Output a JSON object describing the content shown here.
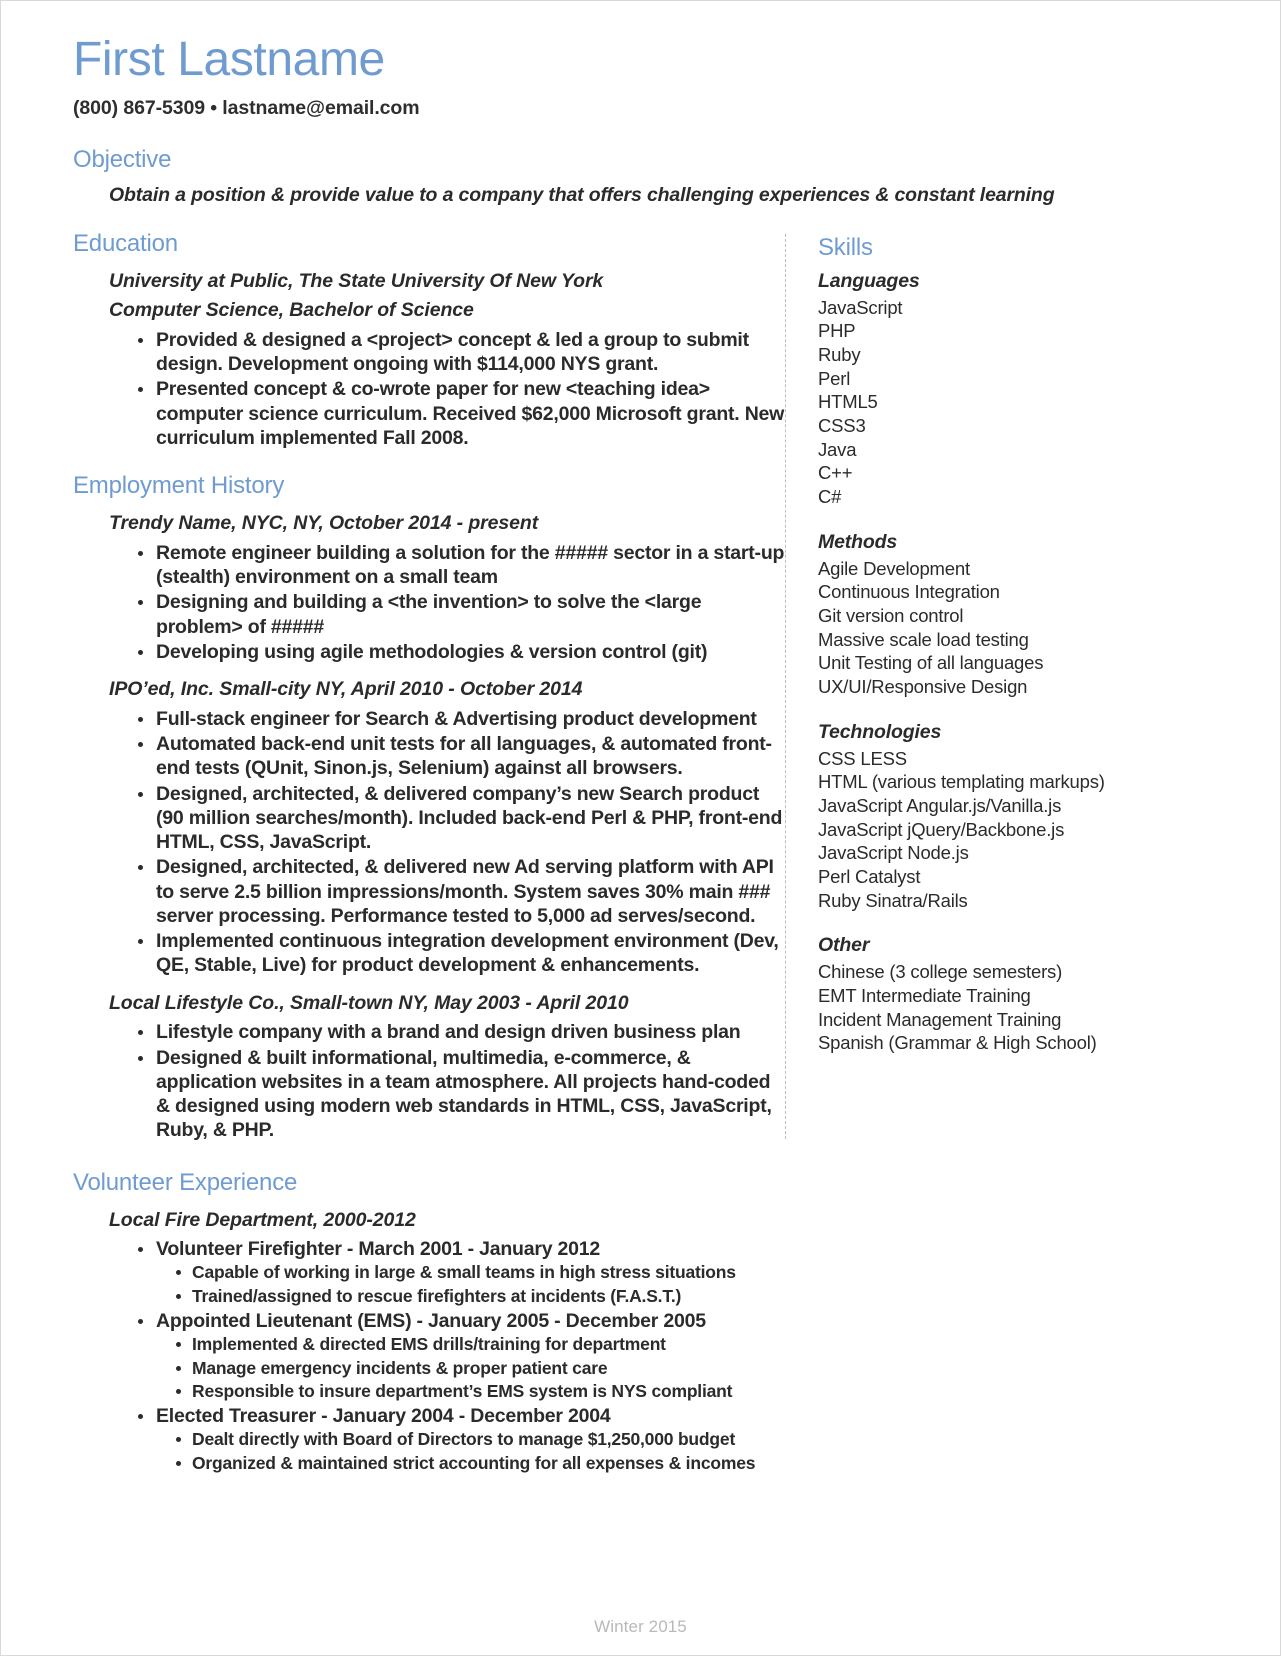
{
  "header": {
    "name": "First Lastname",
    "contact": "(800) 867-5309 • lastname@email.com"
  },
  "accent_color": "#6f9bd1",
  "text_color": "#2b2b2b",
  "objective": {
    "heading": "Objective",
    "text": "Obtain a position & provide value to a company that offers challenging experiences & constant learning"
  },
  "education": {
    "heading": "Education",
    "school": "University at Public, The State University Of New York",
    "degree": "Computer Science, Bachelor of Science",
    "bullets": [
      "Provided & designed a <project> concept & led a group to submit design. Development ongoing with $114,000 NYS grant.",
      "Presented concept & co-wrote paper for new <teaching idea> computer science curriculum. Received $62,000 Microsoft grant. New curriculum implemented Fall 2008."
    ]
  },
  "employment": {
    "heading": "Employment History",
    "jobs": [
      {
        "title": "Trendy Name, NYC, NY, October 2014 - present",
        "bullets": [
          "Remote engineer building a solution for the ##### sector in a start-up (stealth) environment on a small team",
          "Designing and building a <the invention> to solve the <large problem> of #####",
          "Developing using agile methodologies & version control (git)"
        ]
      },
      {
        "title": "IPO’ed, Inc. Small-city NY, April 2010 - October 2014",
        "bullets": [
          "Full-stack engineer for Search & Advertising product development",
          "Automated back-end unit tests for all languages, & automated front-end tests (QUnit, Sinon.js, Selenium) against all browsers.",
          "Designed, architected, & delivered company’s new Search product (90 million searches/month). Included back-end Perl & PHP, front-end HTML, CSS, JavaScript.",
          "Designed, architected, & delivered new Ad serving platform with API to serve 2.5 billion impressions/month. System saves 30% main ### server processing. Performance tested to 5,000 ad serves/second.",
          "Implemented continuous integration development environment (Dev, QE, Stable, Live) for product development & enhancements."
        ]
      },
      {
        "title": "Local Lifestyle Co., Small-town NY, May 2003 - April 2010",
        "bullets": [
          "Lifestyle company with a brand and design driven business plan",
          "Designed & built informational, multimedia, e-commerce, & application websites in a team atmosphere. All projects hand-coded & designed using modern web standards in HTML, CSS, JavaScript, Ruby, & PHP."
        ]
      }
    ]
  },
  "skills": {
    "heading": "Skills",
    "groups": [
      {
        "title": "Languages",
        "items": [
          "JavaScript",
          "PHP",
          "Ruby",
          "Perl",
          "HTML5",
          "CSS3",
          "Java",
          "C++",
          "C#"
        ]
      },
      {
        "title": "Methods",
        "items": [
          "Agile Development",
          "Continuous Integration",
          "Git version control",
          "Massive scale load testing",
          "Unit Testing of all languages",
          "UX/UI/Responsive Design"
        ]
      },
      {
        "title": "Technologies",
        "items": [
          "CSS LESS",
          "HTML (various templating markups)",
          "JavaScript Angular.js/Vanilla.js",
          "JavaScript jQuery/Backbone.js",
          "JavaScript Node.js",
          "Perl Catalyst",
          "Ruby Sinatra/Rails"
        ]
      },
      {
        "title": "Other",
        "items": [
          "Chinese (3 college semesters)",
          "EMT Intermediate Training",
          "Incident Management Training",
          "Spanish (Grammar & High School)"
        ]
      }
    ]
  },
  "volunteer": {
    "heading": "Volunteer Experience",
    "org": "Local Fire Department, 2000-2012",
    "roles": [
      {
        "title": "Volunteer Firefighter - March 2001 - January 2012",
        "bullets": [
          "Capable of working in large & small teams in high stress situations",
          "Trained/assigned to rescue firefighters at incidents (F.A.S.T.)"
        ]
      },
      {
        "title": "Appointed Lieutenant (EMS) - January 2005 - December 2005",
        "bullets": [
          "Implemented & directed EMS drills/training for department",
          "Manage emergency incidents & proper patient care",
          "Responsible to insure department’s EMS system is NYS compliant"
        ]
      },
      {
        "title": "Elected Treasurer - January 2004 - December 2004",
        "bullets": [
          "Dealt directly with Board of Directors to manage $1,250,000 budget",
          "Organized & maintained strict accounting for all expenses & incomes"
        ]
      }
    ]
  },
  "footer": {
    "text": "Winter 2015"
  }
}
